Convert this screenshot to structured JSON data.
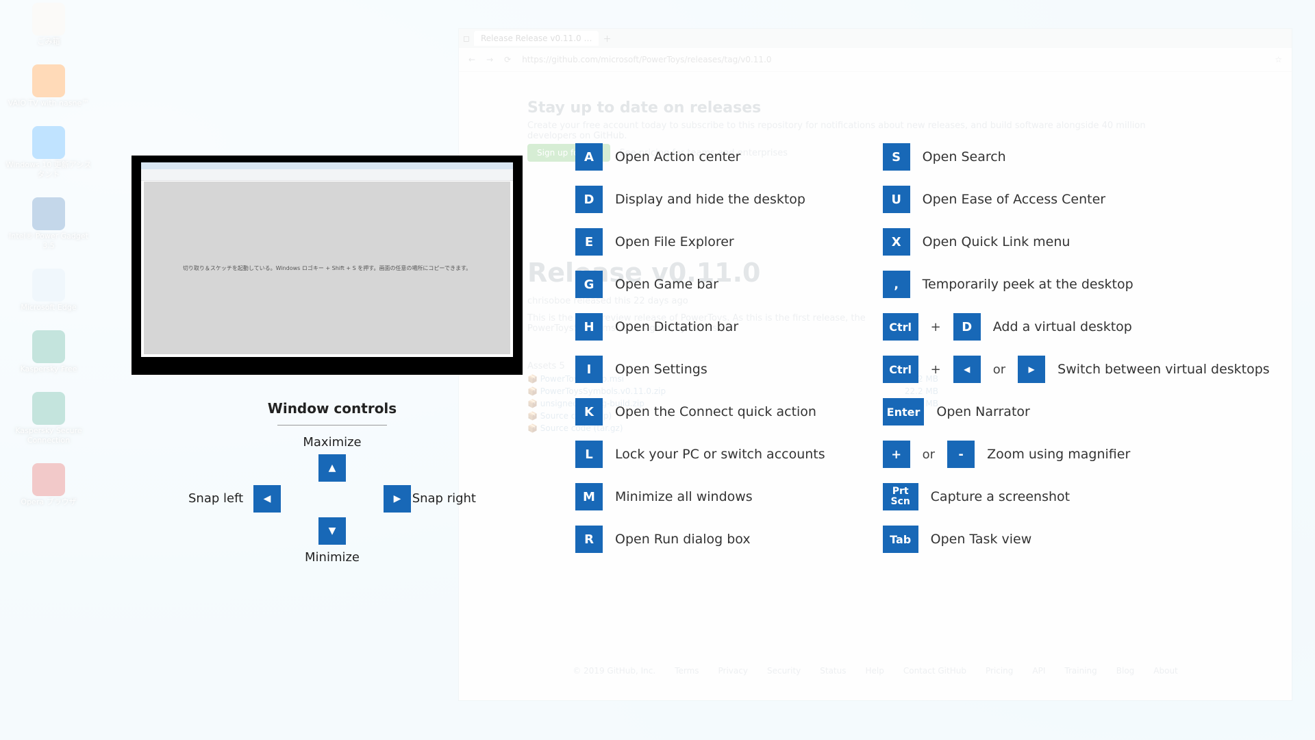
{
  "desktop": {
    "icons": [
      {
        "label": "ごみ箱",
        "color": "#efeee5"
      },
      {
        "label": "VAIO TV with nasne™",
        "color": "#ff7a00"
      },
      {
        "label": "Windows 10 更新アシスタント",
        "color": "#1f9bff"
      },
      {
        "label": "Intel® Power Gadget 3.5",
        "color": "#2b6fb4"
      },
      {
        "label": "Microsoft Edge",
        "color": "#c9e2f4"
      },
      {
        "label": "Kaspersky Free",
        "color": "#2d9d87"
      },
      {
        "label": "Kaspersky Secure Connection",
        "color": "#2d9d87"
      },
      {
        "label": "Opera ブラウザ",
        "color": "#d13d3d"
      }
    ]
  },
  "browser": {
    "tab": "Release Release v0.11.0 …",
    "url": "https://github.com/microsoft/PowerToys/releases/tag/v0.11.0",
    "heading": "Stay up to date on releases",
    "sub1": "Create your free account today to subscribe to this repository for notifications about new releases, and build software alongside 40 million developers on GitHub.",
    "sub2": "See pricing for teams and enterprises",
    "releaseTitle": "Release v0.11.0",
    "releaseTag": "v0.11.0",
    "releaseWhen": "chrisoboe released this 22 days ago",
    "releaseBody": "This is the first preview release of PowerToys. As this is the first release, the  PowerToysSetup.msi  isn't signed by Microsoft.",
    "assetsLabel": "Assets 5",
    "files": [
      {
        "name": "PowerToysSetup.msi",
        "size": "2.02 MB"
      },
      {
        "name": "PowerToysSymbols.v0.11.0.zip",
        "size": "22.2 MB"
      },
      {
        "name": "unsigned-debug-build.zip",
        "size": "4.53 MB"
      },
      {
        "name": "Source code (zip)",
        "size": ""
      },
      {
        "name": "Source code (tar.gz)",
        "size": ""
      }
    ],
    "footer": [
      "© 2019 GitHub, Inc.",
      "Terms",
      "Privacy",
      "Security",
      "Status",
      "Help",
      "Contact GitHub",
      "Pricing",
      "API",
      "Training",
      "Blog",
      "About"
    ]
  },
  "shot_text": "切り取り＆スケッチを起動している。Windows ロゴキー + Shift + S を押す。画面の任意の場所にコピーできます。",
  "windowControls": {
    "title": "Window controls",
    "up": "Maximize",
    "down": "Minimize",
    "left": "Snap left",
    "right": "Snap right"
  },
  "shortcutsLeft": [
    {
      "keys": [
        "A"
      ],
      "desc": "Open Action center"
    },
    {
      "keys": [
        "D"
      ],
      "desc": "Display and hide the desktop"
    },
    {
      "keys": [
        "E"
      ],
      "desc": "Open File Explorer"
    },
    {
      "keys": [
        "G"
      ],
      "desc": "Open Game bar"
    },
    {
      "keys": [
        "H"
      ],
      "desc": "Open Dictation bar"
    },
    {
      "keys": [
        "I"
      ],
      "desc": "Open Settings"
    },
    {
      "keys": [
        "K"
      ],
      "desc": "Open the Connect quick action"
    },
    {
      "keys": [
        "L"
      ],
      "desc": "Lock your PC or switch accounts"
    },
    {
      "keys": [
        "M"
      ],
      "desc": "Minimize all windows"
    },
    {
      "keys": [
        "R"
      ],
      "desc": "Open Run dialog box"
    }
  ],
  "shortcutsRight": [
    {
      "keys": [
        "S"
      ],
      "desc": "Open Search"
    },
    {
      "keys": [
        "U"
      ],
      "desc": "Open Ease of Access Center"
    },
    {
      "keys": [
        "X"
      ],
      "desc": "Open Quick Link menu"
    },
    {
      "keys": [
        "',"
      ],
      "show": ",",
      "desc": "Temporarily peek at the desktop"
    },
    {
      "combo": [
        {
          "k": "Ctrl",
          "wide": true
        },
        "+",
        {
          "k": "D"
        }
      ],
      "desc": "Add a virtual desktop"
    },
    {
      "combo": [
        {
          "k": "Ctrl",
          "wide": true
        },
        "+",
        {
          "k": "◀",
          "tri": true
        },
        "or",
        {
          "k": "▶",
          "tri": true
        }
      ],
      "desc": "Switch between virtual desktops"
    },
    {
      "keys": [
        "Enter"
      ],
      "wide": true,
      "desc": "Open Narrator"
    },
    {
      "combo": [
        {
          "k": "+"
        },
        "or",
        {
          "k": "-"
        }
      ],
      "desc": "Zoom using magnifier"
    },
    {
      "keys": [
        "Prt\nScn"
      ],
      "prtscn": true,
      "desc": "Capture a screenshot"
    },
    {
      "keys": [
        "Tab"
      ],
      "wide": true,
      "desc": "Open Task view"
    }
  ]
}
